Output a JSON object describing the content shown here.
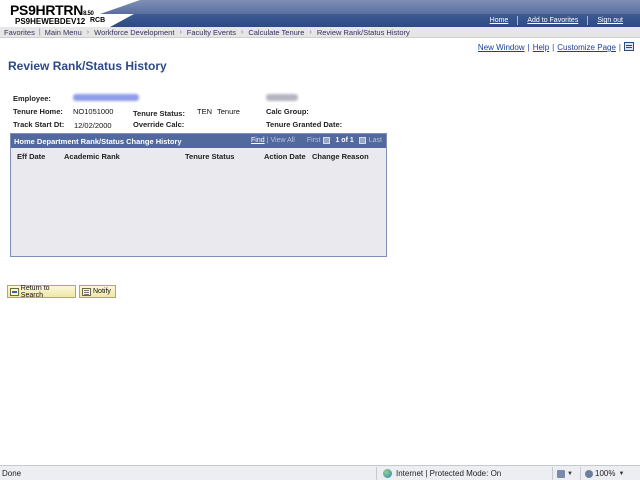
{
  "header": {
    "app_title": "PS9HRTRN",
    "app_version": "8.50",
    "database": "PS9HEWEBDEV12",
    "user": "RCB",
    "links": [
      "Home",
      "Add to Favorites",
      "Sign out"
    ]
  },
  "breadcrumb": {
    "items": [
      "Favorites",
      "Main Menu",
      "Workforce Development",
      "Faculty Events",
      "Calculate Tenure",
      "Review Rank/Status History"
    ]
  },
  "page_links": {
    "new_window": "New Window",
    "help": "Help",
    "customize_page": "Customize Page"
  },
  "page_title": "Review Rank/Status History",
  "form": {
    "employee_label": "Employee:",
    "tenure_home_label": "Tenure Home:",
    "tenure_home_value": "NO1051000",
    "tenure_status_label": "Tenure Status:",
    "tenure_status_code": "TEN",
    "tenure_status_value": "Tenure",
    "calc_group_label": "Calc Group:",
    "track_start_label": "Track Start Dt:",
    "track_start_value": "12/02/2000",
    "override_calc_label": "Override Calc:",
    "tenure_granted_label": "Tenure Granted Date:"
  },
  "grid": {
    "title": "Home Department Rank/Status Change History",
    "find": "Find",
    "view_all": "View All",
    "first": "First",
    "page_range": "1 of 1",
    "last": "Last",
    "columns": [
      "Eff Date",
      "Academic Rank",
      "Tenure Status",
      "Action Date",
      "Change Reason"
    ]
  },
  "buttons": {
    "return_to_search": "Return to Search",
    "notify": "Notify"
  },
  "statusbar": {
    "left_text": "Done",
    "zone_text": "Internet | Protected Mode: On",
    "zoom": "100%"
  },
  "colors": {
    "header_blue": "#2c4a86",
    "title_blue": "#2c4a86",
    "grid_header": "#52699e",
    "button_bg": "#efe6a8"
  }
}
